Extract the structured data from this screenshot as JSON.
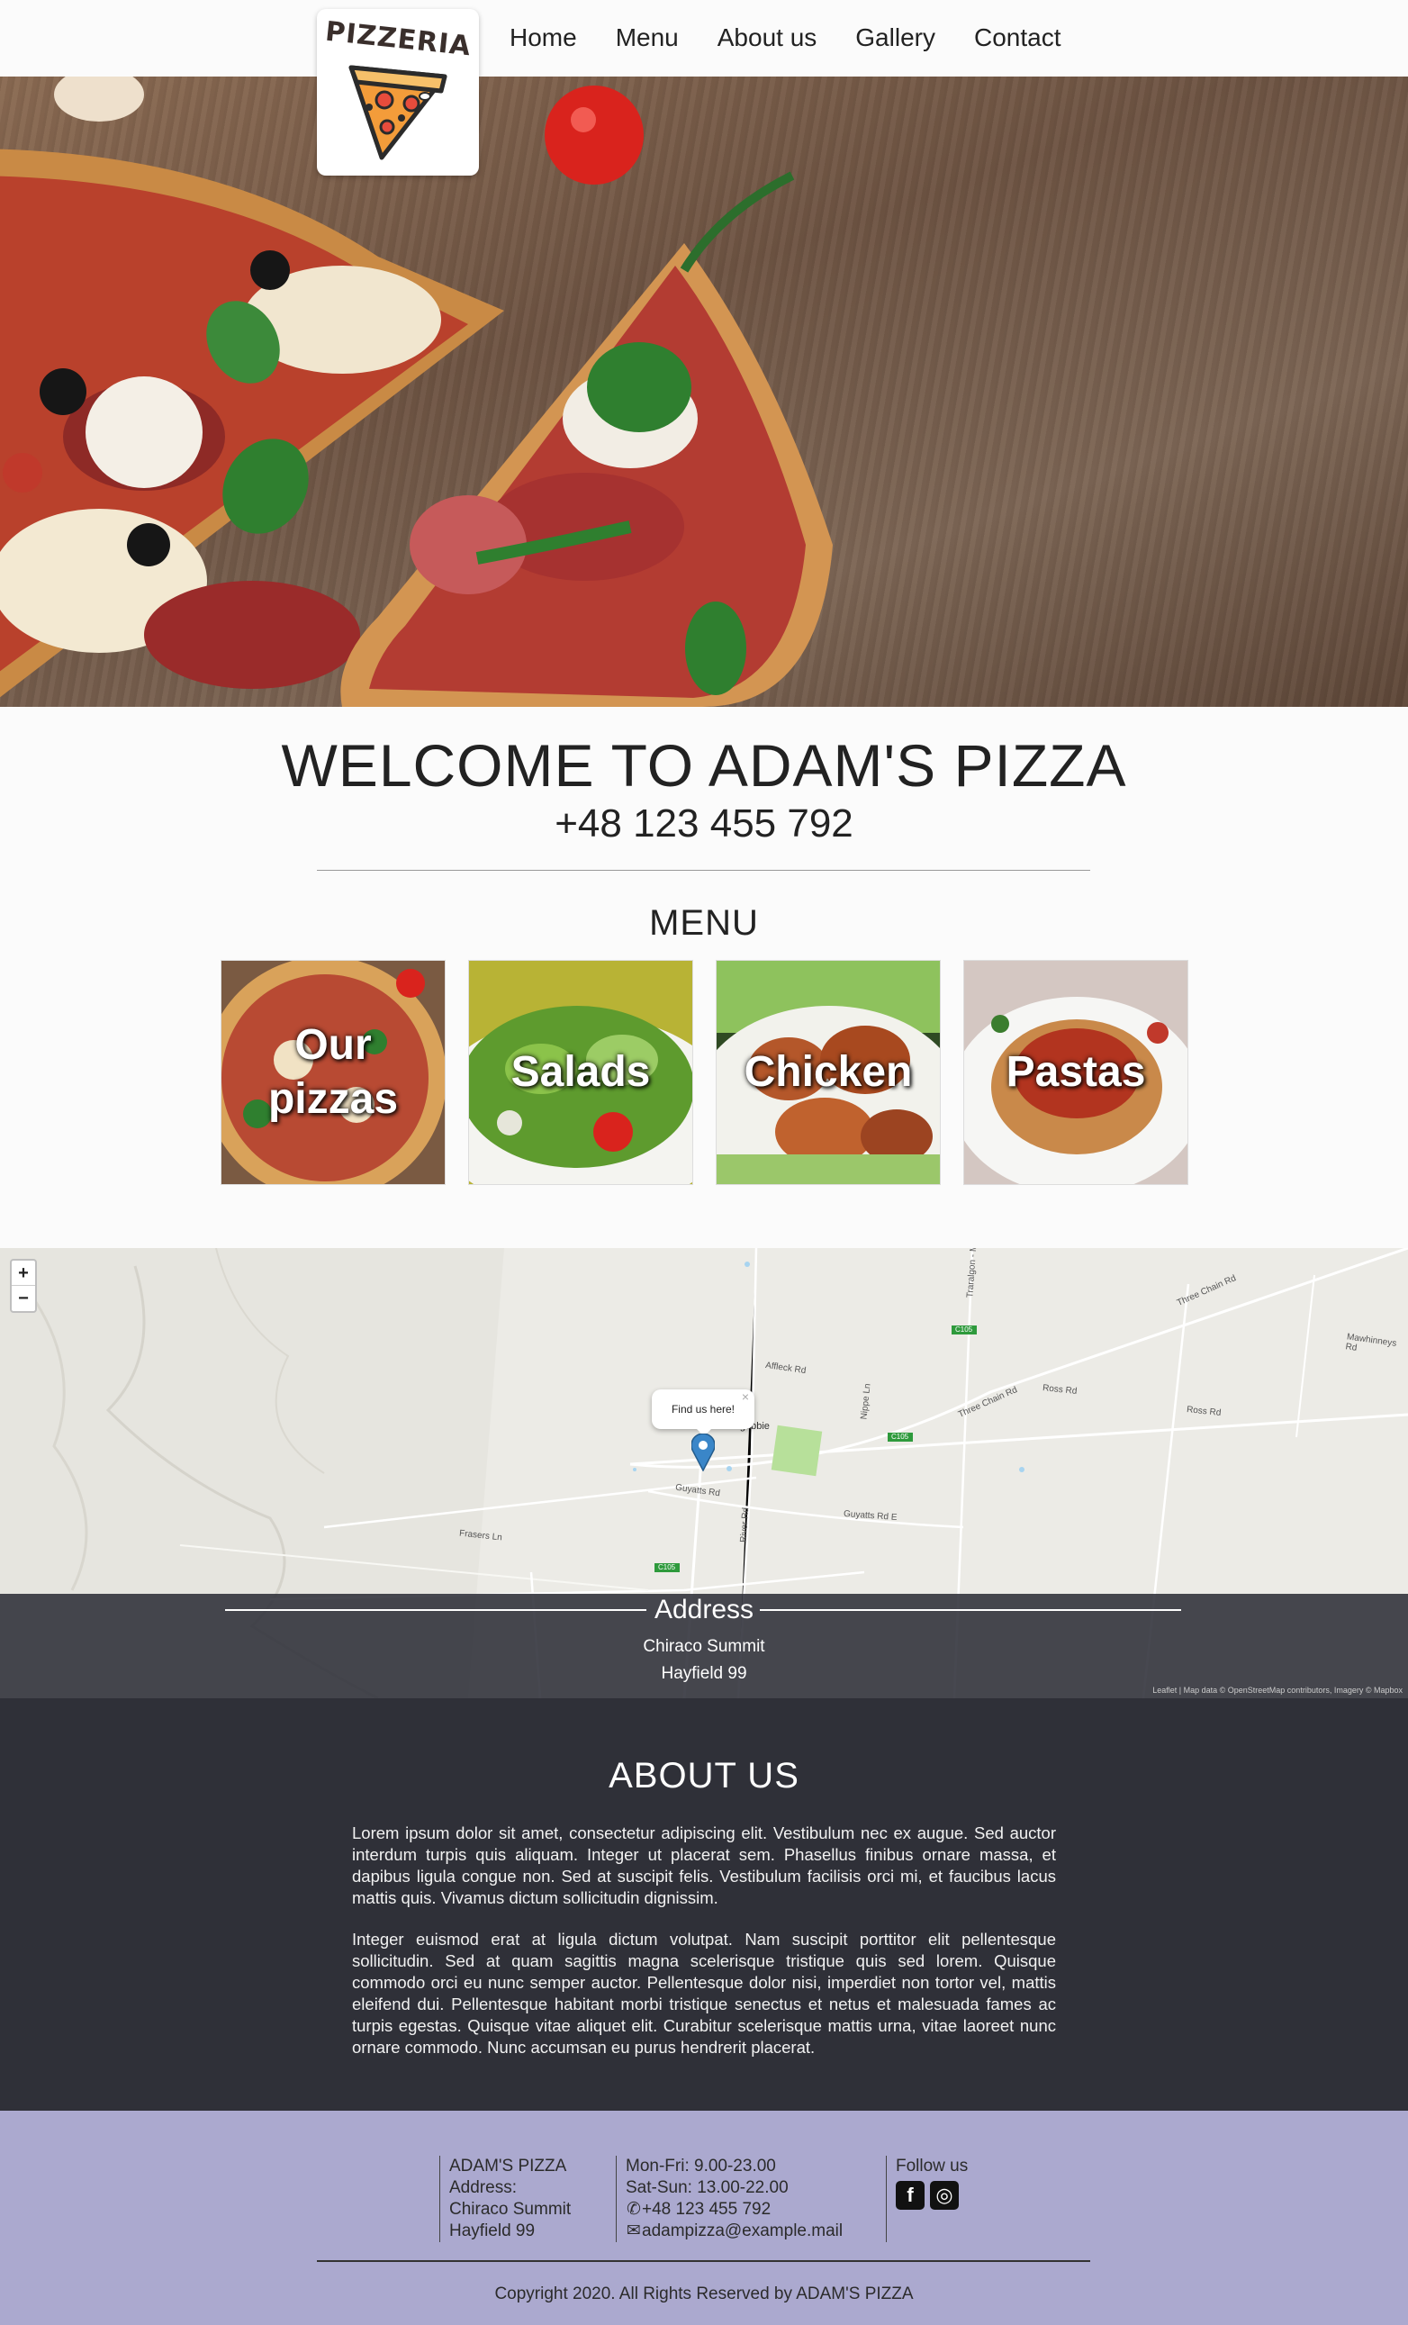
{
  "header": {
    "logo_text": "PIZZERIA",
    "nav": [
      "Home",
      "Menu",
      "About us",
      "Gallery",
      "Contact"
    ]
  },
  "welcome": {
    "title": "WELCOME TO ADAM'S PIZZA",
    "phone": "+48 123 455 792"
  },
  "menu": {
    "title": "MENU",
    "tiles": [
      {
        "label": "Our pizzas"
      },
      {
        "label": "Salads"
      },
      {
        "label": "Chicken"
      },
      {
        "label": "Pastas"
      }
    ]
  },
  "map": {
    "zoom_in": "+",
    "zoom_out": "−",
    "popup": "Find us here!",
    "popup_close": "×",
    "labels": [
      "Three Chain Rd",
      "Mawhinneys Rd",
      "Affleck Rd",
      "Ross Rd",
      "Ross Rd",
      "Three Chain Rd",
      "Nippe Ln",
      "Guyatts Rd",
      "Guyatts Rd E",
      "Frasers Ln",
      "River Rd",
      "Traralgon - M",
      "Toongabbie",
      "C105",
      "C105",
      "C105"
    ],
    "attribution": "Leaflet | Map data © OpenStreetMap contributors, Imagery © Mapbox"
  },
  "address": {
    "title": "Address",
    "line1": "Chiraco Summit",
    "line2": "Hayfield 99"
  },
  "about": {
    "title": "ABOUT US",
    "p1": "Lorem ipsum dolor sit amet, consectetur adipiscing elit. Vestibulum nec ex augue. Sed auctor interdum turpis quis aliquam. Integer ut placerat sem. Phasellus finibus ornare massa, et dapibus ligula congue non. Sed at suscipit felis. Vestibulum facilisis orci mi, et faucibus lacus mattis quis. Vivamus dictum sollicitudin dignissim.",
    "p2": "Integer euismod erat at ligula dictum volutpat. Nam suscipit porttitor elit pellentesque sollicitudin. Sed at quam sagittis magna scelerisque tristique quis sed lorem. Quisque commodo orci eu nunc semper auctor. Pellentesque dolor nisi, imperdiet non tortor vel, mattis eleifend dui. Pellentesque habitant morbi tristique senectus et netus et malesuada fames ac turpis egestas. Quisque vitae aliquet elit. Curabitur scelerisque mattis urna, vitae laoreet nunc ornare commodo. Nunc accumsan eu purus hendrerit placerat."
  },
  "footer": {
    "col1": [
      "ADAM'S PIZZA",
      "Address:",
      "Chiraco Summit",
      "Hayfield 99"
    ],
    "col2": [
      "Mon-Fri: 9.00-23.00",
      "Sat-Sun: 13.00-22.00",
      "+48 123 455 792",
      "adampizza@example.mail"
    ],
    "follow": "Follow us",
    "facebook_glyph": "f",
    "instagram_glyph": "◎",
    "copyright": "Copyright 2020. All Rights Reserved by ADAM'S PIZZA"
  }
}
